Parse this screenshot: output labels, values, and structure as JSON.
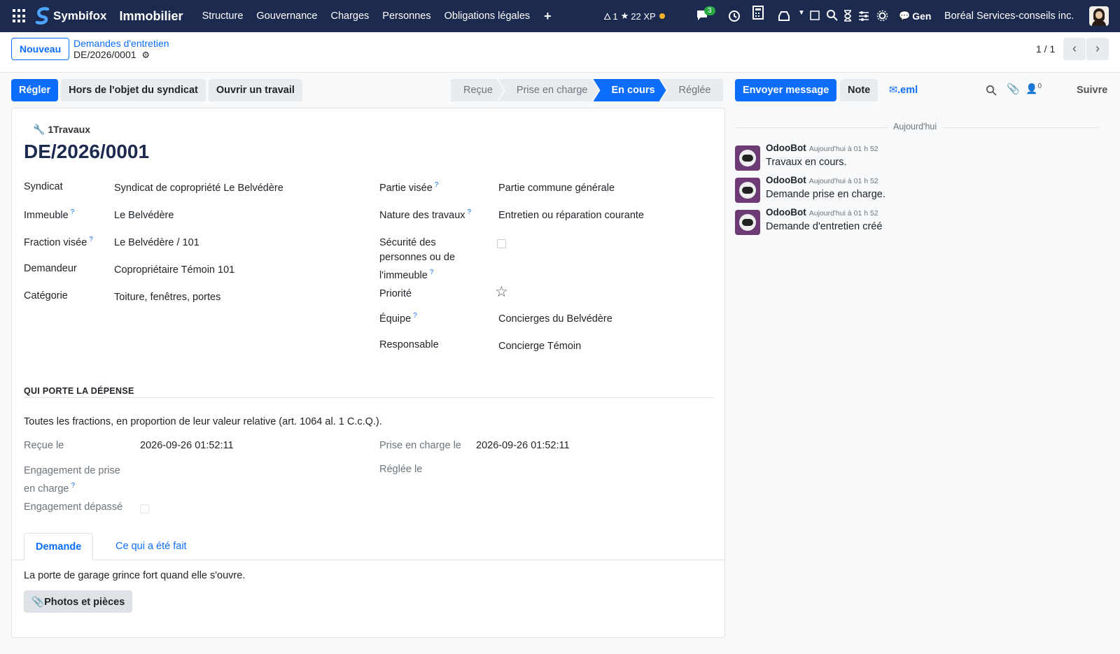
{
  "topbar": {
    "brand": "Symbifox",
    "app_name": "Immobilier",
    "menu": [
      "Structure",
      "Gouvernance",
      "Charges",
      "Personnes",
      "Obligations légales"
    ],
    "gamification": {
      "streak": "1",
      "xp": "22 XP"
    },
    "messages_count": "3",
    "ai_label": "Gen",
    "company": "Boréal Services-conseils inc.",
    "colors": {
      "bg": "#1b2a4e",
      "badge": "#28a745",
      "dot": "#f0b429"
    }
  },
  "subbar": {
    "new_button": "Nouveau",
    "breadcrumb_parent": "Demandes d'entretien",
    "breadcrumb_current": "DE/2026/0001",
    "pager": "1 / 1"
  },
  "actions": [
    "Régler",
    "Hors de l'objet du syndicat",
    "Ouvrir un travail"
  ],
  "statusbar": [
    {
      "label": "Reçue",
      "active": false
    },
    {
      "label": "Prise en charge",
      "active": false
    },
    {
      "label": "En cours",
      "active": true
    },
    {
      "label": "Réglée",
      "active": false
    }
  ],
  "form": {
    "smart_button": "1Travaux",
    "title": "DE/2026/0001",
    "left_fields": [
      {
        "label": "Syndicat",
        "value": "Syndicat de copropriété Le Belvédère",
        "tip": false
      },
      {
        "label": "Immeuble",
        "value": "Le Belvédère",
        "tip": true
      },
      {
        "label": "Fraction visée",
        "value": "Le Belvédère / 101",
        "tip": true
      },
      {
        "label": "Demandeur",
        "value": "Copropriétaire Témoin 101",
        "tip": false
      },
      {
        "label": "Catégorie",
        "value": "Toiture, fenêtres, portes",
        "tip": false
      }
    ],
    "right_fields": {
      "partie_visee": {
        "label": "Partie visée",
        "value": "Partie commune générale"
      },
      "nature": {
        "label": "Nature des travaux",
        "value": "Entretien ou réparation courante"
      },
      "securite": {
        "label_l1": "Sécurité des",
        "label_l2": "personnes ou de",
        "label_l3": "l'immeuble"
      },
      "priorite": {
        "label": "Priorité"
      },
      "equipe": {
        "label": "Équipe",
        "value": "Concierges du Belvédère"
      },
      "responsable": {
        "label": "Responsable",
        "value": "Concierge Témoin"
      }
    },
    "section_title": "QUI PORTE LA DÉPENSE",
    "section_text": "Toutes les fractions, en proportion de leur valeur relative (art. 1064 al. 1 C.c.Q.).",
    "dates": {
      "recue_label": "Reçue le",
      "recue_value": "2026-09-26 01:52:11",
      "prise_label": "Prise en charge le",
      "prise_value": "2026-09-26 01:52:11",
      "engagement_l1": "Engagement de prise",
      "engagement_l2": "en charge",
      "reglee_label": "Réglée le",
      "depasse_label": "Engagement dépassé"
    },
    "tabs": [
      {
        "label": "Demande",
        "active": true
      },
      {
        "label": "Ce qui a été fait",
        "active": false
      }
    ],
    "tab_content": "La porte de garage grince fort quand elle s'ouvre.",
    "attach_button": "Photos et pièces"
  },
  "chatter": {
    "send_button": "Envoyer message",
    "note_button": "Note",
    "eml_button": ".eml",
    "followers_count": "0",
    "follow_button": "Suivre",
    "date_separator": "Aujourd'hui",
    "messages": [
      {
        "author": "OdooBot",
        "date": "Aujourd'hui à 01 h 52",
        "body": "Travaux en cours."
      },
      {
        "author": "OdooBot",
        "date": "Aujourd'hui à 01 h 52",
        "body": "Demande prise en charge."
      },
      {
        "author": "OdooBot",
        "date": "Aujourd'hui à 01 h 52",
        "body": "Demande d'entretien créé"
      }
    ]
  }
}
